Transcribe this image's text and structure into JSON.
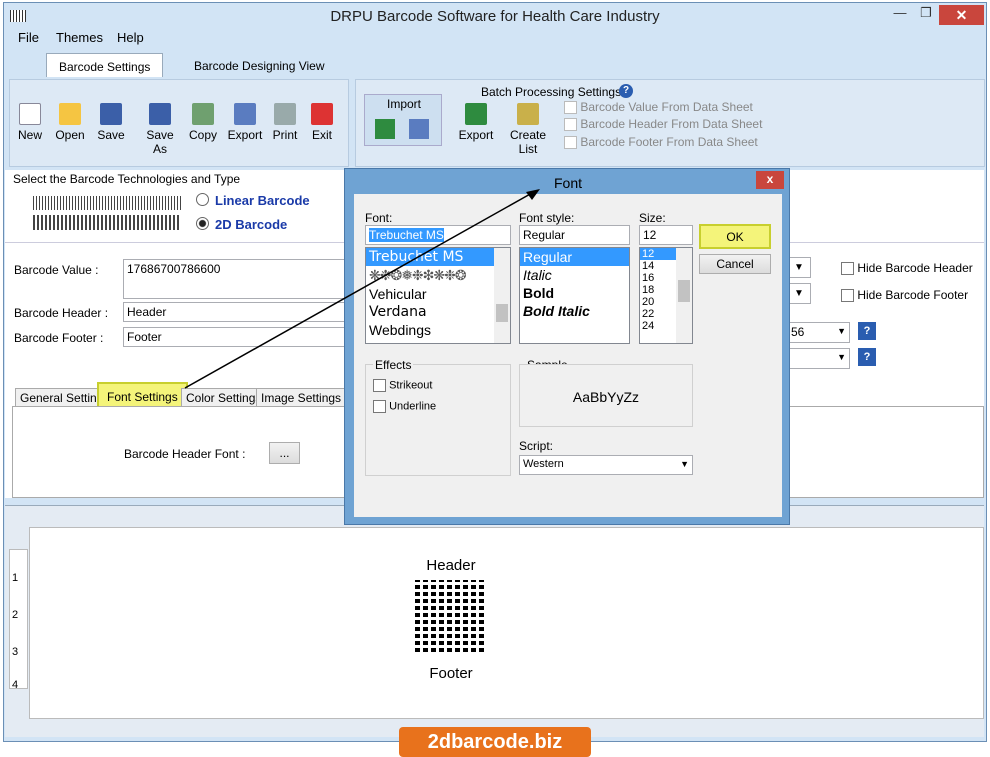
{
  "window": {
    "title": "DRPU Barcode Software for Health Care Industry"
  },
  "menu": [
    "File",
    "Themes",
    "Help"
  ],
  "tabs": [
    "Barcode Settings",
    "Barcode Designing View"
  ],
  "toolbar": {
    "new": "New",
    "open": "Open",
    "save": "Save",
    "save_as": "Save As",
    "copy": "Copy",
    "export": "Export",
    "print": "Print",
    "exit": "Exit"
  },
  "batch": {
    "title": "Batch Processing Settings",
    "import": "Import",
    "export": "Export",
    "create_list": "Create List",
    "value_from": "Barcode Value From Data Sheet",
    "header_from": "Barcode Header From Data Sheet",
    "footer_from": "Barcode Footer From Data Sheet"
  },
  "tech": {
    "heading": "Select the Barcode Technologies and Type",
    "linear": "Linear Barcode",
    "twod": "2D Barcode"
  },
  "form": {
    "value_label": "Barcode Value :",
    "value": "17686700786600",
    "header_label": "Barcode Header :",
    "header": "Header",
    "footer_label": "Barcode Footer :",
    "footer": "Footer",
    "hide_header": "Hide Barcode Header",
    "hide_footer": "Hide Barcode Footer",
    "combo_value": "56"
  },
  "subtabs": [
    "General Settings",
    "Font Settings",
    "Color Settings",
    "Image Settings"
  ],
  "font_settings": {
    "header_font_label": "Barcode Header Font :",
    "browse": "..."
  },
  "dialog": {
    "title": "Font",
    "close": "x",
    "font_label": "Font:",
    "font_value": "Trebuchet MS",
    "fonts": [
      "Trebuchet MS",
      "Vehicular",
      "Verdana",
      "Webdings"
    ],
    "style_label": "Font style:",
    "style_value": "Regular",
    "styles": [
      "Regular",
      "Italic",
      "Bold",
      "Bold Italic"
    ],
    "size_label": "Size:",
    "size_value": "12",
    "sizes": [
      "12",
      "14",
      "16",
      "18",
      "20",
      "22",
      "24"
    ],
    "ok": "OK",
    "cancel": "Cancel",
    "effects_label": "Effects",
    "strikeout": "Strikeout",
    "underline": "Underline",
    "sample_label": "Sample",
    "sample_text": "AaBbYyZz",
    "script_label": "Script:",
    "script_value": "Western"
  },
  "preview": {
    "header": "Header",
    "footer": "Footer",
    "ruler": [
      "1",
      "2",
      "3",
      "4"
    ]
  },
  "watermark": "2dbarcode.biz",
  "colors": {
    "accent": "#3399ff",
    "highlight": "#f4f47a",
    "watermark": "#e8721c"
  }
}
